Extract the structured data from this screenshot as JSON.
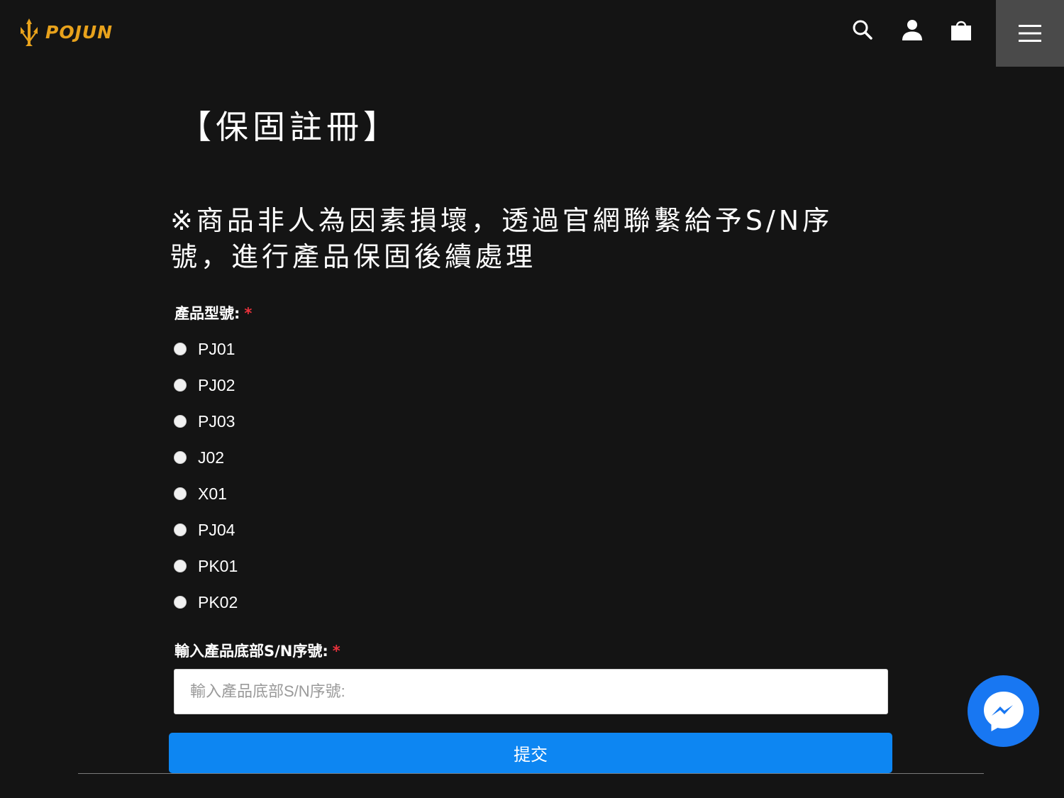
{
  "header": {
    "logo_text": "POJUN",
    "icons": {
      "search": "search-icon",
      "account": "user-icon",
      "cart": "shopping-bag-icon",
      "menu": "hamburger-menu-icon"
    }
  },
  "page": {
    "title": "【保固註冊】",
    "notice": "※商品非人為因素損壞，透過官網聯繫給予S/N序號，進行產品保固後續處理"
  },
  "form": {
    "model_label": "產品型號:",
    "required_mark": "*",
    "models": [
      "PJ01",
      "PJ02",
      "PJ03",
      "J02",
      "X01",
      "PJ04",
      "PK01",
      "PK02"
    ],
    "sn_label": "輸入產品底部S/N序號:",
    "sn_placeholder": "輸入產品底部S/N序號:",
    "sn_value": "",
    "submit_label": "提交"
  },
  "colors": {
    "background": "#141414",
    "brand": "#e8a21c",
    "required": "#e8323c",
    "submit": "#0d86f2",
    "messenger": "#1877f2"
  },
  "chat": {
    "icon": "messenger-icon"
  }
}
